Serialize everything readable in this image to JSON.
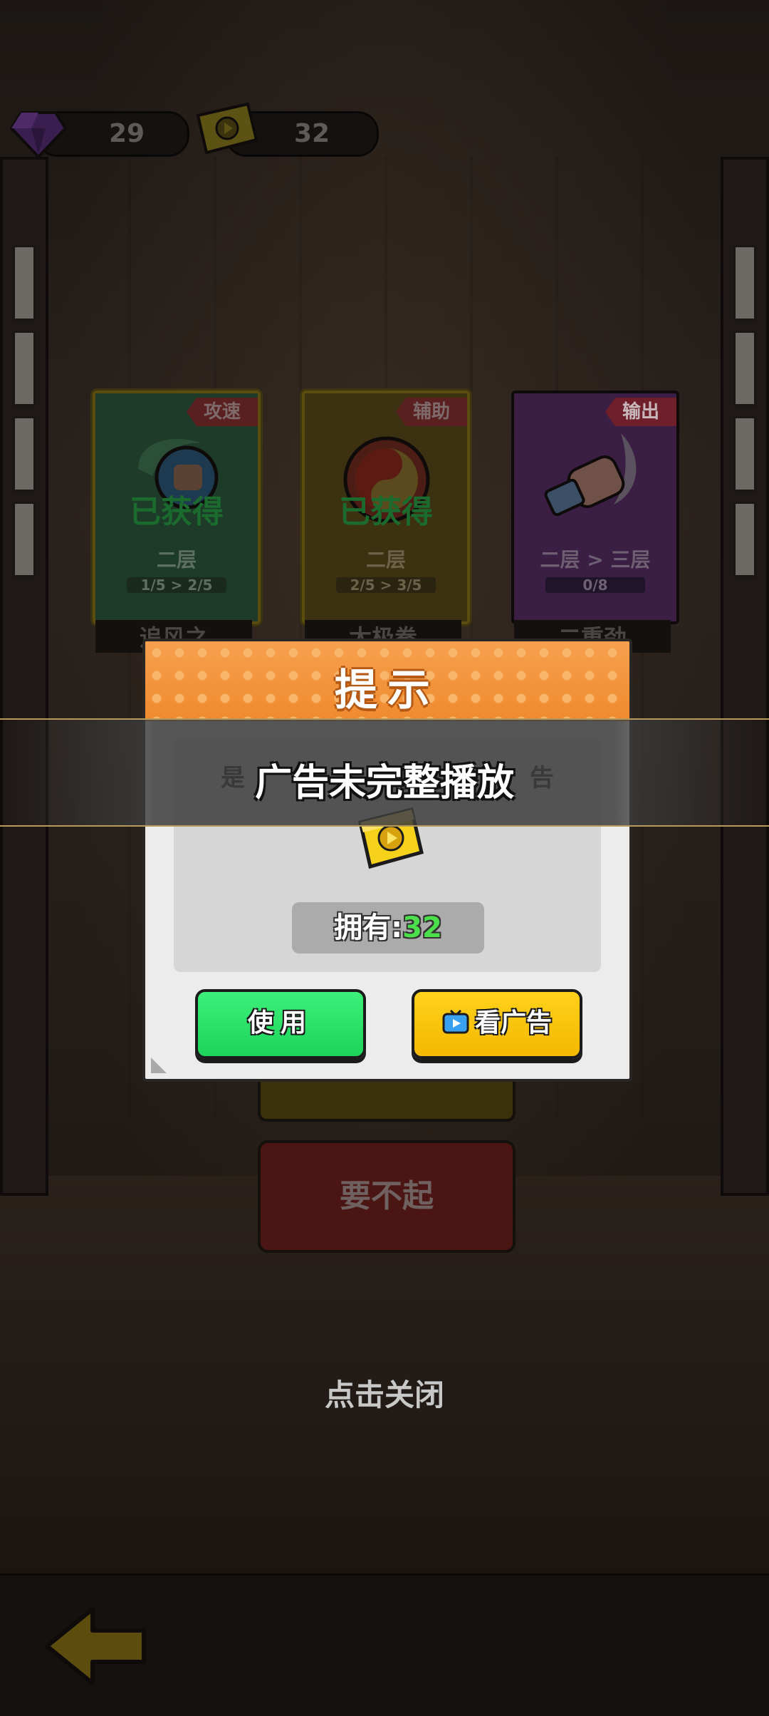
{
  "currency": {
    "gems": "29",
    "tickets": "32"
  },
  "cards": [
    {
      "tag": "攻速",
      "status": "已获得",
      "level": "二层",
      "progress": "1/5 > 2/5",
      "name": "追风之",
      "tag_color": "#a33a3a",
      "bg": "#1e3a28"
    },
    {
      "tag": "辅助",
      "status": "已获得",
      "level": "二层",
      "progress": "2/5 > 3/5",
      "name": "太极拳",
      "tag_color": "#a33a3a",
      "bg": "#3c3212"
    },
    {
      "tag": "输出",
      "status": "",
      "level": "二层 > 三层",
      "progress": "0/8",
      "name": "二重劲",
      "tag_color": "#e0334a",
      "bg": "#3a1e44"
    }
  ],
  "popup": {
    "title": "提示",
    "description_partial_left": "是",
    "description_partial_right": "告",
    "own_label": "拥有:",
    "own_count": "32",
    "use_button": "使用",
    "ad_button": "看广告"
  },
  "toast": {
    "text": "广告未完整播放"
  },
  "background_buttons": {
    "refuse": "要不起"
  },
  "tap_to_close": "点击关闭",
  "colors": {
    "use_green": "#22d862",
    "ad_yellow": "#f8c000",
    "header_orange": "#f0902f",
    "own_count_green": "#4be04b"
  }
}
